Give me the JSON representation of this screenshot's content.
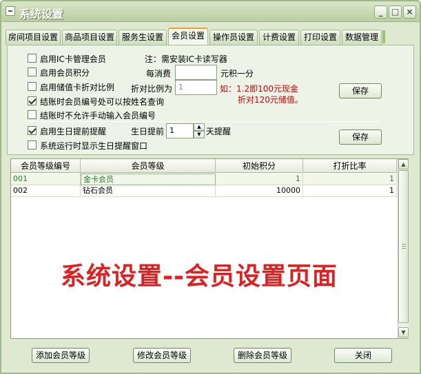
{
  "window": {
    "title": "系统设置",
    "controls": {
      "min": "_",
      "max": "□",
      "close": "×"
    }
  },
  "tabs": [
    {
      "label": "房间项目设置"
    },
    {
      "label": "商品项目设置"
    },
    {
      "label": "服务生设置"
    },
    {
      "label": "会员设置",
      "active": true
    },
    {
      "label": "操作员设置"
    },
    {
      "label": "计费设置"
    },
    {
      "label": "打印设置"
    },
    {
      "label": "数据管理"
    }
  ],
  "settings": {
    "ic_card": {
      "label": "启用IC卡管理会员",
      "checked": false
    },
    "ic_note": "注：需安装IC卡读写器",
    "points": {
      "label": "启用会员积分",
      "checked": false
    },
    "per_spend_label": "每消费",
    "per_spend_value": "",
    "points_unit": "元积一分",
    "stored_card": {
      "label": "启用储值卡折对比例",
      "checked": false
    },
    "ratio_label": "折对比例为",
    "ratio_value": "1",
    "ratio_example_line1": "如：1.2即100元现金",
    "ratio_example_line2": "折对120元储值。",
    "save_label_1": "保存",
    "name_lookup": {
      "label": "结账时会员编号处可以按姓名查询",
      "checked": true
    },
    "no_manual": {
      "label": "结账时不允许手动输入会员编号",
      "checked": false
    },
    "birthday": {
      "label": "启用生日提前提醒",
      "checked": true
    },
    "birthday_days_label": "生日提前",
    "birthday_days_value": "1",
    "birthday_days_unit": "天提醒",
    "startup_birthday": {
      "label": "系统运行时显示生日提醒窗口",
      "checked": false
    },
    "save_label_2": "保存"
  },
  "grid": {
    "columns": [
      "会员等级编号",
      "会员等级",
      "初始积分",
      "打折比率"
    ],
    "rows": [
      {
        "code": "001",
        "name": "金卡会员",
        "points": "1",
        "discount": "1",
        "selected": true
      },
      {
        "code": "002",
        "name": "钻石会员",
        "points": "10000",
        "discount": "1",
        "selected": false
      }
    ]
  },
  "overlay_caption": "系统设置--会员设置页面",
  "buttons": {
    "add": "添加会员等级",
    "edit": "修改会员等级",
    "delete": "删除会员等级",
    "close": "关闭"
  },
  "colors": {
    "accent_tab": "#f0a030",
    "caption": "#e02020",
    "selected_row_text": "#2e7d32"
  }
}
